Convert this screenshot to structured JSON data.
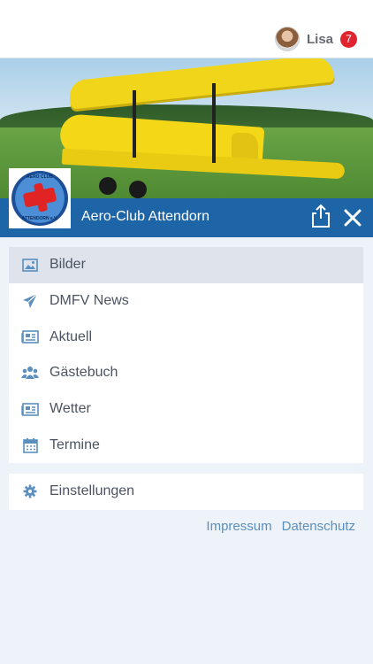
{
  "header": {
    "user_name": "Lisa",
    "notification_count": "7",
    "avatar_icon": "user-avatar"
  },
  "hero": {
    "image": "yellow-biplane-photo",
    "club_name": "Aero-Club Attendorn",
    "logo_text_top": "AERO CLUB",
    "logo_text_bottom": "ATTENDORN e.V.",
    "share_icon": "share-icon",
    "close_icon": "close-icon"
  },
  "menu": {
    "items": [
      {
        "label": "Bilder",
        "icon": "image-icon",
        "active": true
      },
      {
        "label": "DMFV News",
        "icon": "paper-plane-icon",
        "active": false
      },
      {
        "label": "Aktuell",
        "icon": "newspaper-icon",
        "active": false
      },
      {
        "label": "Gästebuch",
        "icon": "users-icon",
        "active": false
      },
      {
        "label": "Wetter",
        "icon": "newspaper-icon",
        "active": false
      },
      {
        "label": "Termine",
        "icon": "calendar-icon",
        "active": false
      }
    ],
    "settings": {
      "label": "Einstellungen",
      "icon": "gear-icon"
    }
  },
  "footer": {
    "impressum": "Impressum",
    "datenschutz": "Datenschutz"
  },
  "colors": {
    "brand_blue": "#1d65a6",
    "badge_red": "#e0242f",
    "link_blue": "#5b8fbf",
    "icon_blue": "#5b8fbf"
  }
}
